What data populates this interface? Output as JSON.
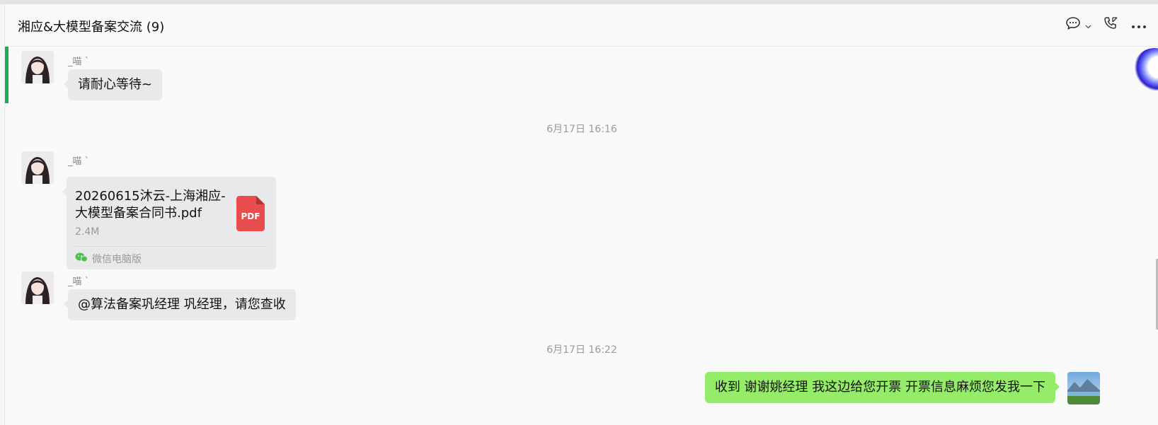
{
  "window": {
    "title": "湘应&大模型备案交流 (9)"
  },
  "header_icons": [
    "chat-icon",
    "chevron-down-icon",
    "video-call-icon",
    "more-icon"
  ],
  "messages": [
    {
      "type": "text",
      "sender": "_喵 `",
      "text": "请耐心等待~"
    },
    {
      "type": "timestamp",
      "text": "6月17日 16:16"
    },
    {
      "type": "file",
      "sender": "_喵 `",
      "file_name": "20260615沐云-上海湘应-大模型备案合同书.pdf",
      "file_size": "2.4M",
      "file_icon_label": "PDF",
      "source": "微信电脑版"
    },
    {
      "type": "text",
      "sender": "_喵 `",
      "text": "@算法备案巩经理 巩经理，请您查收"
    },
    {
      "type": "timestamp",
      "text": "6月17日 16:22"
    },
    {
      "type": "text",
      "self": true,
      "text": "收到 谢谢姚经理 我这边给您开票  开票信息麻烦您发我一下"
    }
  ],
  "colors": {
    "self_bubble": "#95ec69",
    "other_bubble": "#e9e9eb",
    "accent": "#1aad52",
    "pdf_red": "#e84c4c"
  }
}
